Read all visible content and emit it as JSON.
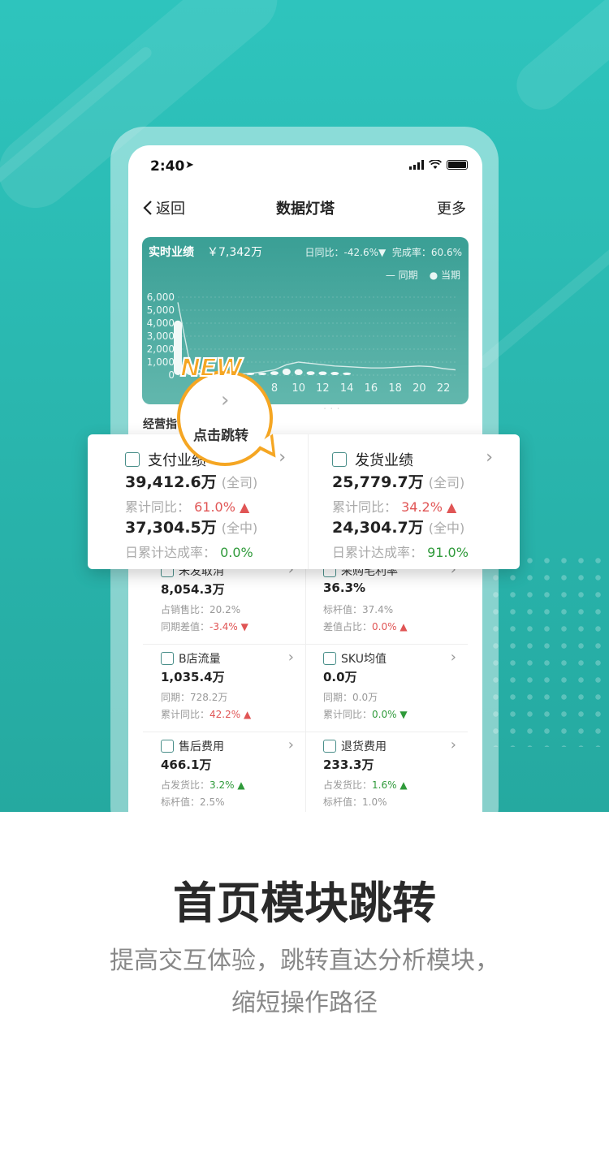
{
  "status_bar": {
    "time": "2:40"
  },
  "navbar": {
    "back_label": "返回",
    "title": "数据灯塔",
    "more_label": "更多"
  },
  "realtime": {
    "title": "实时业绩",
    "amount": "￥7,342万",
    "dod_label": "日同比：-42.6%▼",
    "completion_label": "完成率：60.6%",
    "legend_prev": "同期",
    "legend_curr": "当期"
  },
  "chart_data": {
    "type": "bar",
    "categories": [
      "0",
      "1",
      "2",
      "3",
      "4",
      "5",
      "6",
      "7",
      "8",
      "9",
      "10",
      "11",
      "12",
      "13",
      "14",
      "15",
      "16",
      "17",
      "18",
      "19",
      "20",
      "21",
      "22",
      "23"
    ],
    "series": [
      {
        "name": "当期",
        "values": [
          4200,
          800,
          200,
          100,
          80,
          60,
          90,
          150,
          300,
          500,
          450,
          300,
          280,
          250,
          200,
          null,
          null,
          null,
          null,
          null,
          null,
          null,
          null,
          null
        ]
      },
      {
        "name": "同期",
        "values": [
          5600,
          900,
          300,
          150,
          100,
          80,
          120,
          250,
          400,
          800,
          1000,
          900,
          800,
          700,
          650,
          600,
          550,
          550,
          600,
          650,
          700,
          650,
          500,
          400
        ]
      }
    ],
    "ylim": [
      0,
      6000
    ],
    "yticks": [
      "6,000",
      "5,000",
      "4,000",
      "3,000",
      "2,000",
      "1,000",
      "0"
    ],
    "xticks": [
      "8",
      "10",
      "12",
      "14",
      "16",
      "18",
      "20",
      "22"
    ],
    "legend_position": "top-right"
  },
  "section": {
    "label": "经营指"
  },
  "popup": {
    "left": {
      "title": "支付业绩",
      "value1": "39,412.6万",
      "value1_scope": "(全司)",
      "yoy_label": "累计同比：",
      "yoy_value": "61.0%",
      "value2": "37,304.5万",
      "value2_scope": "(全中)",
      "rate_label": "日累计达成率：",
      "rate_value": "0.0%"
    },
    "right": {
      "title": "发货业绩",
      "value1": "25,779.7万",
      "value1_scope": "(全司)",
      "yoy_label": "累计同比：",
      "yoy_value": "34.2%",
      "value2": "24,304.7万",
      "value2_scope": "(全中)",
      "rate_label": "日累计达成率：",
      "rate_value": "91.0%"
    }
  },
  "bubble": {
    "badge": "NEW",
    "text": "点击跳转"
  },
  "cells": [
    {
      "title": "未发取消",
      "value": "8,054.3万",
      "l1_label": "占销售比：",
      "l1_value": "20.2%",
      "l2_label": "同期差值：",
      "l2_value": "-3.4%",
      "l2_dir": "down"
    },
    {
      "title": "采购毛利率",
      "value": "36.3%",
      "l1_label": "标杆值：",
      "l1_value": "37.4%",
      "l2_label": "差值占比：",
      "l2_value": "0.0%",
      "l2_dir": "up"
    },
    {
      "title": "B店流量",
      "value": "1,035.4万",
      "l1_label": "同期：",
      "l1_value": "728.2万",
      "l2_label": "累计同比：",
      "l2_value": "42.2%",
      "l2_dir": "up"
    },
    {
      "title": "SKU均值",
      "value": "0.0万",
      "l1_label": "同期：",
      "l1_value": "0.0万",
      "l2_label": "累计同比：",
      "l2_value": "0.0%",
      "l2_dir": "down"
    },
    {
      "title": "售后费用",
      "value": "466.1万",
      "l1_label": "占发货比：",
      "l1_value": "3.2%",
      "l1_dir": "up",
      "l2_label": "标杆值：",
      "l2_value": "2.5%"
    },
    {
      "title": "退货费用",
      "value": "233.3万",
      "l1_label": "占发货比：",
      "l1_value": "1.6%",
      "l1_dir": "up",
      "l2_label": "标杆值：",
      "l2_value": "1.0%"
    }
  ],
  "promo": {
    "title": "首页模块跳转",
    "subtitle_line1": "提高交互体验，跳转直达分析模块，",
    "subtitle_line2": "缩短操作路径"
  },
  "colors": {
    "teal": "#2ec4bd",
    "accent_orange": "#f5a623",
    "red": "#e05555",
    "green": "#2f9a3a"
  }
}
